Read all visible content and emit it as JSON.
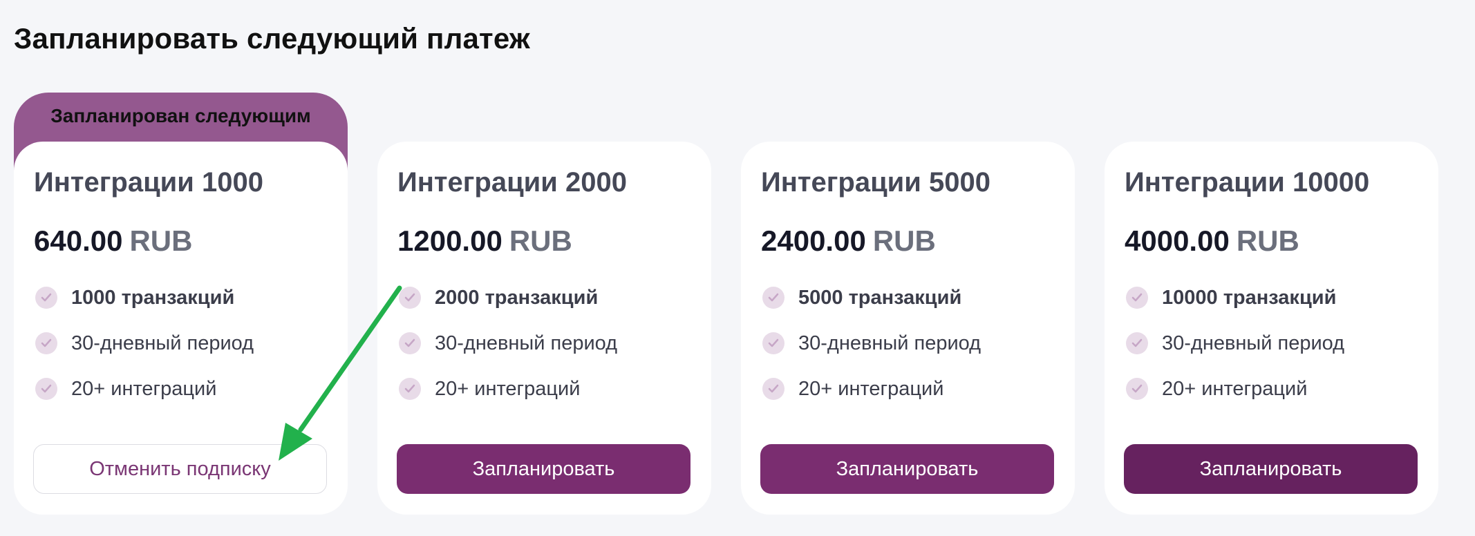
{
  "page": {
    "title": "Запланировать следующий платеж"
  },
  "badge": {
    "label": "Запланирован следующим"
  },
  "cards": [
    {
      "title": "Интеграции 1000",
      "price": "640.00",
      "currency": "RUB",
      "features": [
        {
          "strong": "1000",
          "text": " транзакций"
        },
        {
          "strong": "",
          "text": "30-дневный период"
        },
        {
          "strong": "",
          "text": "20+ интеграций"
        }
      ],
      "button_label": "Отменить подписку"
    },
    {
      "title": "Интеграции 2000",
      "price": "1200.00",
      "currency": "RUB",
      "features": [
        {
          "strong": "2000",
          "text": " транзакций"
        },
        {
          "strong": "",
          "text": "30-дневный период"
        },
        {
          "strong": "",
          "text": "20+ интеграций"
        }
      ],
      "button_label": "Запланировать"
    },
    {
      "title": "Интеграции 5000",
      "price": "2400.00",
      "currency": "RUB",
      "features": [
        {
          "strong": "5000",
          "text": " транзакций"
        },
        {
          "strong": "",
          "text": "30-дневный период"
        },
        {
          "strong": "",
          "text": "20+ интеграций"
        }
      ],
      "button_label": "Запланировать"
    },
    {
      "title": "Интеграции 10000",
      "price": "4000.00",
      "currency": "RUB",
      "features": [
        {
          "strong": "10000",
          "text": " транзакций"
        },
        {
          "strong": "",
          "text": "30-дневный период"
        },
        {
          "strong": "",
          "text": "20+ интеграций"
        }
      ],
      "button_label": "Запланировать"
    }
  ],
  "colors": {
    "accent": "#7a2d70",
    "badge": "#94588f",
    "annotation_arrow": "#22b14c"
  },
  "icons": {
    "feature": "check-circle-icon",
    "annotation": "arrow-annotation-icon"
  }
}
